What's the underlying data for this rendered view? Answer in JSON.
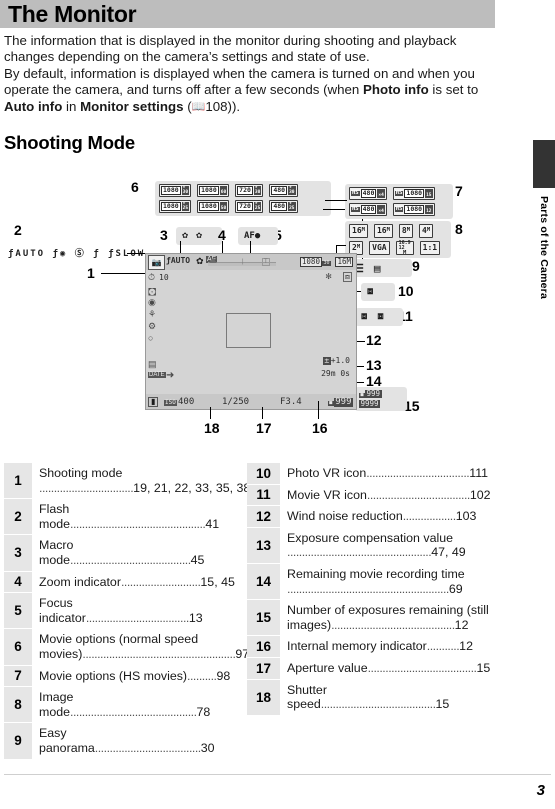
{
  "header": {
    "title": "The Monitor",
    "section_heading": "Shooting Mode",
    "side_tab": "Parts of the Camera",
    "page_number": "3"
  },
  "intro": {
    "line1": "The information that is displayed in the monitor during shooting and playback",
    "line2": "changes depending on the camera’s settings and state of use.",
    "line3": "By default, information is displayed when the camera is turned on and when",
    "line4_a": "you operate the camera, and turns off after a few seconds (when ",
    "line4_b": "Photo info",
    "line4_c": " is",
    "line5_a": "set to ",
    "line5_b": "Auto info",
    "line5_c": " in ",
    "line5_d": "Monitor settings",
    "line5_e": " (",
    "line5_f": "108))."
  },
  "figure": {
    "callouts": {
      "n1": "1",
      "n2": "2",
      "n3": "3",
      "n4": "4",
      "n5": "5",
      "n6": "6",
      "n7": "7",
      "n8": "8",
      "n9": "9",
      "n10": "10",
      "n11": "11",
      "n12": "12",
      "n13": "13",
      "n14": "14",
      "n15": "15",
      "n16": "16",
      "n17": "17",
      "n18": "18"
    },
    "flash_modes": {
      "label": "flash-mode-icons",
      "items": [
        "ƒAUTO",
        "ƒ◉",
        "ⓕ",
        "ƒ",
        "ƒSLOW"
      ]
    },
    "movie_options_normal": {
      "row1": [
        {
          "res": "1080",
          "fps_top": "★",
          "fps_bot": "30"
        },
        {
          "res": "1080",
          "fps_top": "",
          "fps_bot": "60"
        },
        {
          "res": "720",
          "fps_top": "★",
          "fps_bot": "30"
        },
        {
          "res": "480",
          "fps_top": "★",
          "fps_bot": "30"
        }
      ],
      "row2": [
        {
          "res": "1080",
          "fps_top": "★",
          "fps_bot": "25"
        },
        {
          "res": "1080",
          "fps_top": "",
          "fps_bot": "50"
        },
        {
          "res": "720",
          "fps_top": "★",
          "fps_bot": "25"
        },
        {
          "res": "480",
          "fps_top": "★",
          "fps_bot": "25"
        }
      ]
    },
    "movie_options_hs": {
      "row1": [
        {
          "hs": "HS",
          "res": "480",
          "fps": "×4"
        },
        {
          "hs": "HS",
          "res": "1080",
          "fps": "15"
        }
      ],
      "row2": [
        {
          "hs": "HS",
          "res": "480",
          "fps": "×4"
        },
        {
          "hs": "HS",
          "res": "1080",
          "fps": "12"
        }
      ]
    },
    "image_modes": {
      "row1": [
        "16M",
        "16M",
        "8M",
        "4M"
      ],
      "row2": [
        "2M",
        "VGA",
        "16:9 12M",
        "1:1"
      ]
    },
    "easy_panorama_icons": [
      "panorama-normal",
      "panorama-wide"
    ],
    "photo_vr_icons": [
      "photo-vr"
    ],
    "movie_vr_icons": [
      "movie-vr-on",
      "movie-vr-active"
    ],
    "macro_icons": [
      "macro-flower",
      "macro-off"
    ],
    "focus_indicator": "AF●",
    "monitor": {
      "mode_icon": "camera-auto-mode",
      "flash_value": "ƒAUTO",
      "macro_value": "macro-icon",
      "zoom_bar": "zoom-indicator",
      "movie_option_value": "1080",
      "movie_option_fps": "30",
      "image_mode_value": "16M",
      "wind_noise_value": "wind-noise-icon",
      "movie_vr_value": "movie-vr-icon",
      "self_timer": "10",
      "left_icons": [
        "self-timer-icon",
        "continuous-icon",
        "iso-sensitivity-icon",
        "ae-af-lock-icon",
        "white-balance-icon",
        "color-options-icon",
        "metering-icon"
      ],
      "date_stamp": "DATE",
      "battery_icon": "battery-icon",
      "iso_label": "ISO",
      "iso_value": "400",
      "shutter_speed": "1/250",
      "aperture": "F3.4",
      "exposure_comp": "+1.0",
      "movie_time": "29m 0s",
      "exposures_remaining": "999",
      "internal_memory_value": "999"
    },
    "exposure_badges": {
      "still_remaining": "999",
      "still_remaining_alt": "9999"
    }
  },
  "legend_left": [
    {
      "num": "1",
      "text": "Shooting mode",
      "pages": "19, 21, 22, 33, 35, 38",
      "wrap": true
    },
    {
      "num": "2",
      "text": "Flash mode",
      "pages": "41",
      "wrap": false
    },
    {
      "num": "3",
      "text": "Macro mode",
      "pages": "45",
      "wrap": false
    },
    {
      "num": "4",
      "text": "Zoom indicator",
      "pages": "15, 45",
      "wrap": false
    },
    {
      "num": "5",
      "text": "Focus indicator",
      "pages": "13",
      "wrap": false
    },
    {
      "num": "6",
      "text": "Movie options (normal speed movies)",
      "pages": "97",
      "wrap": true
    },
    {
      "num": "7",
      "text": "Movie options (HS movies)",
      "pages": "98",
      "wrap": false
    },
    {
      "num": "8",
      "text": "Image mode",
      "pages": "78",
      "wrap": false
    },
    {
      "num": "9",
      "text": "Easy panorama",
      "pages": "30",
      "wrap": false
    }
  ],
  "legend_right": [
    {
      "num": "10",
      "text": "Photo VR icon",
      "pages": "111",
      "wrap": false
    },
    {
      "num": "11",
      "text": "Movie VR icon",
      "pages": "102",
      "wrap": false
    },
    {
      "num": "12",
      "text": "Wind noise reduction",
      "pages": "103",
      "wrap": false
    },
    {
      "num": "13",
      "text": "Exposure compensation value",
      "pages": "47, 49",
      "wrap": true
    },
    {
      "num": "14",
      "text": "Remaining movie recording time",
      "pages": "69",
      "wrap": true
    },
    {
      "num": "15",
      "text": "Number of exposures remaining (still images)",
      "pages": "12",
      "wrap": true
    },
    {
      "num": "16",
      "text": "Internal memory indicator",
      "pages": "12",
      "wrap": false
    },
    {
      "num": "17",
      "text": "Aperture value",
      "pages": "15",
      "wrap": false
    },
    {
      "num": "18",
      "text": "Shutter speed",
      "pages": "15",
      "wrap": false
    }
  ]
}
